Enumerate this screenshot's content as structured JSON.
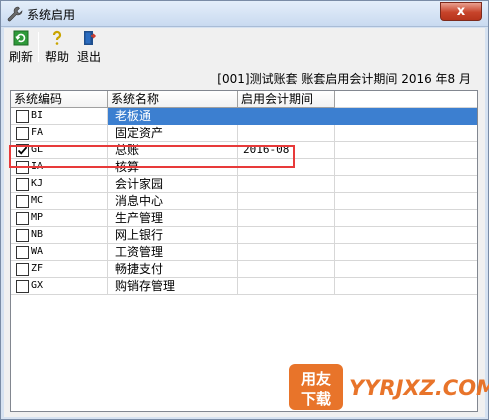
{
  "window": {
    "title": "系统启用",
    "close_label": "x"
  },
  "toolbar": {
    "refresh_label": "刷新",
    "help_label": "帮助",
    "exit_label": "退出"
  },
  "info": "[001]测试账套 账套启用会计期间 2016 年8 月",
  "grid": {
    "columns": [
      "系统编码",
      "系统名称",
      "启用会计期间"
    ],
    "rows": [
      {
        "code": "BI",
        "name": "老板通",
        "period": "",
        "checked": false
      },
      {
        "code": "FA",
        "name": "固定资产",
        "period": "",
        "checked": false
      },
      {
        "code": "GL",
        "name": "总账",
        "period": "2016-08",
        "checked": true
      },
      {
        "code": "IA",
        "name": "核算",
        "period": "",
        "checked": false
      },
      {
        "code": "KJ",
        "name": "会计家园",
        "period": "",
        "checked": false
      },
      {
        "code": "MC",
        "name": "消息中心",
        "period": "",
        "checked": false
      },
      {
        "code": "MP",
        "name": "生产管理",
        "period": "",
        "checked": false
      },
      {
        "code": "NB",
        "name": "网上银行",
        "period": "",
        "checked": false
      },
      {
        "code": "WA",
        "name": "工资管理",
        "period": "",
        "checked": false
      },
      {
        "code": "ZF",
        "name": "畅捷支付",
        "period": "",
        "checked": false
      },
      {
        "code": "GX",
        "name": "购销存管理",
        "period": "",
        "checked": false
      }
    ]
  },
  "watermark": {
    "logo_line1": "用友",
    "logo_line2": "下载",
    "site": "YYRJXZ.COM"
  },
  "colors": {
    "selection": "#3c7fd0",
    "highlight_box": "#e83a3a",
    "titlebar": "#c9daf0"
  }
}
